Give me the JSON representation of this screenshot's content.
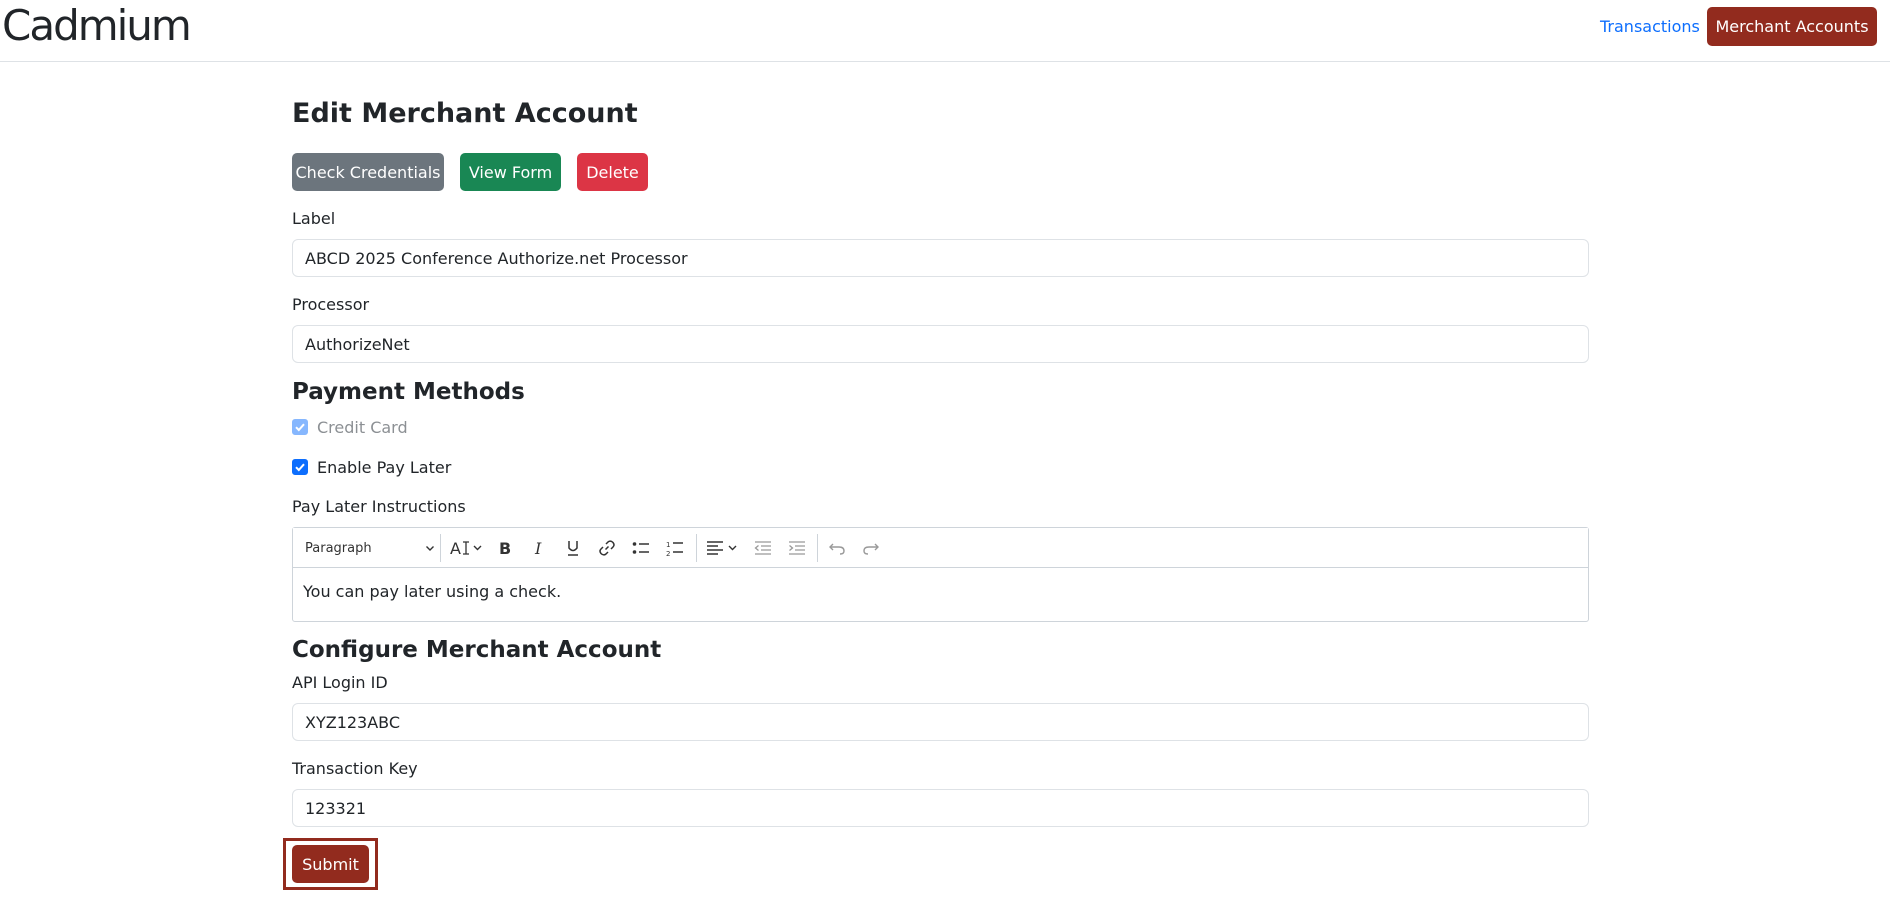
{
  "nav": {
    "brand": "Cadmium",
    "transactions_link": "Transactions",
    "merchant_accounts_button": "Merchant Accounts"
  },
  "page": {
    "title": "Edit Merchant Account"
  },
  "actions": {
    "check_credentials": "Check Credentials",
    "view_form": "View Form",
    "delete": "Delete"
  },
  "form": {
    "label_field": {
      "label": "Label",
      "value": "ABCD 2025 Conference Authorize.net Processor"
    },
    "processor_field": {
      "label": "Processor",
      "value": "AuthorizeNet"
    }
  },
  "payment_methods": {
    "heading": "Payment Methods",
    "credit_card": {
      "label": "Credit Card",
      "checked": true,
      "disabled": true
    },
    "pay_later": {
      "label": "Enable Pay Later",
      "checked": true
    },
    "instructions_label": "Pay Later Instructions",
    "editor": {
      "block_style": "Paragraph",
      "content": "You can pay later using a check."
    }
  },
  "configure": {
    "heading": "Configure Merchant Account",
    "api_login": {
      "label": "API Login ID",
      "value": "XYZ123ABC"
    },
    "transaction_key": {
      "label": "Transaction Key",
      "value": "123321"
    }
  },
  "submit_label": "Submit",
  "colors": {
    "brand": "#922b1e",
    "link": "#0d6efd",
    "secondary": "#6c757d",
    "success": "#198754",
    "danger": "#dc3545"
  }
}
